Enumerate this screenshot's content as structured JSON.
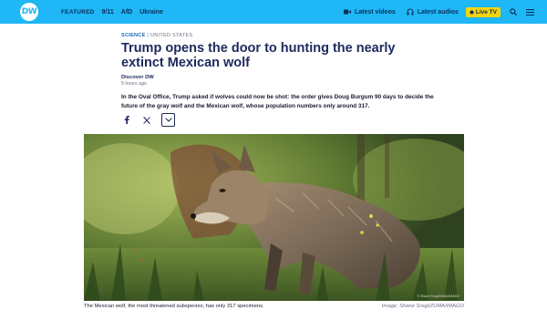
{
  "nav": {
    "logo_text": "DW",
    "featured_label": "FEATURED",
    "links": [
      "9/11",
      "AfD",
      "Ukraine"
    ],
    "latest_videos": "Latest videos",
    "latest_audios": "Latest audios",
    "live_tv": "Live TV",
    "brand_color": "#1fb7f5",
    "live_color": "#f5d40c"
  },
  "article": {
    "category": "SCIENCE",
    "region": "UNITED STATES",
    "headline": "Trump opens the door to hunting the nearly extinct Mexican wolf",
    "author": "Discover DW",
    "time": "5 hours ago",
    "teaser": "In the Oval Office, Trump asked if wolves could now be shot: the order gives Doug Burgum 90 days to decide the future of the gray wolf and the Mexican wolf, whose population numbers only around 317."
  },
  "share": {
    "icons": [
      "facebook-icon",
      "x-icon",
      "chevron-down-icon"
    ]
  },
  "image": {
    "inline_credit": "© Shane Srogi/ZUMA/IMAGO",
    "caption": "The Mexican wolf, the most threatened subspecies, has only 317 specimens.",
    "credit": "Image: Shane Srogi/ZUMA/IMAGO"
  }
}
